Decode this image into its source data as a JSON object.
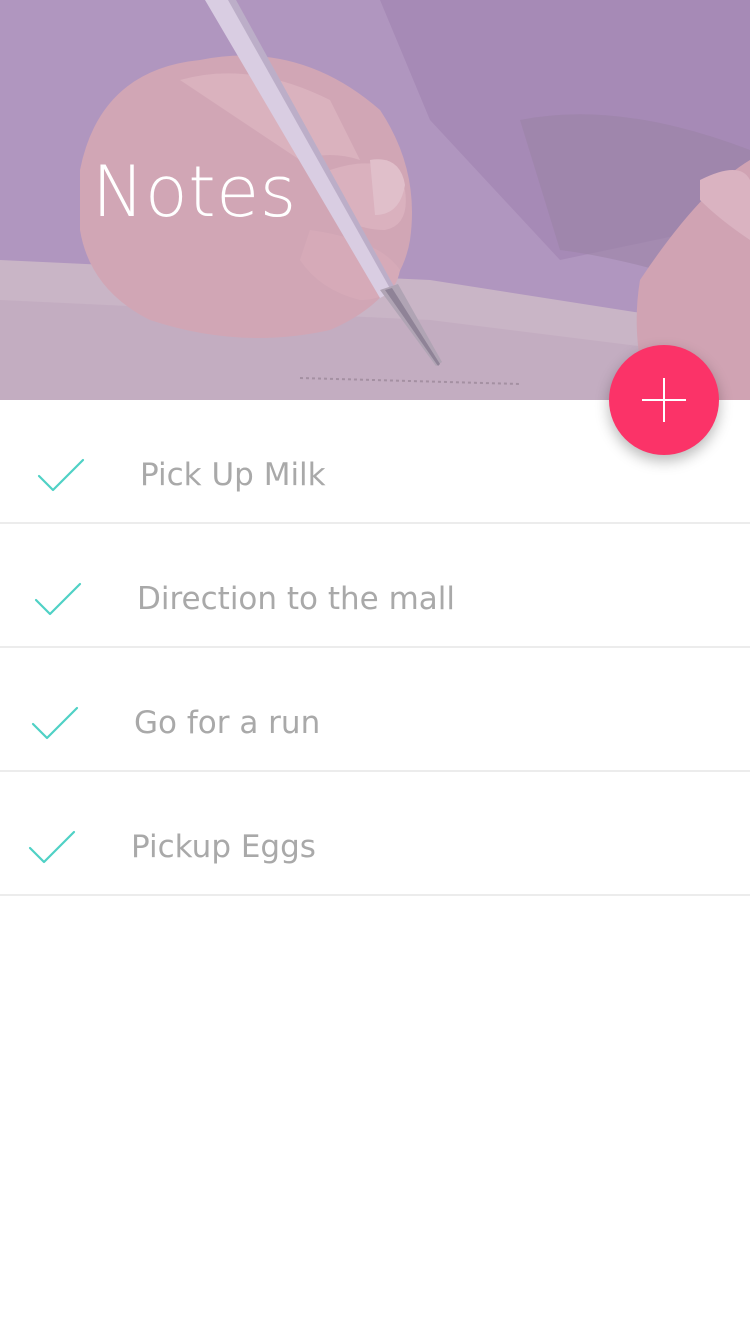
{
  "header": {
    "title": "Notes"
  },
  "fab": {
    "icon": "plus-icon",
    "color": "#fb3368"
  },
  "notes": [
    {
      "label": "Pick Up Milk",
      "icon": "check-icon",
      "completed": true
    },
    {
      "label": "Direction to the mall",
      "icon": "check-icon",
      "completed": true
    },
    {
      "label": "Go for a run",
      "icon": "check-icon",
      "completed": true
    },
    {
      "label": "Pickup Eggs",
      "icon": "check-icon",
      "completed": true
    }
  ],
  "colors": {
    "accent": "#fb3368",
    "check": "#4fd1c5",
    "text": "#a9a9a9",
    "divider": "#ececec"
  }
}
